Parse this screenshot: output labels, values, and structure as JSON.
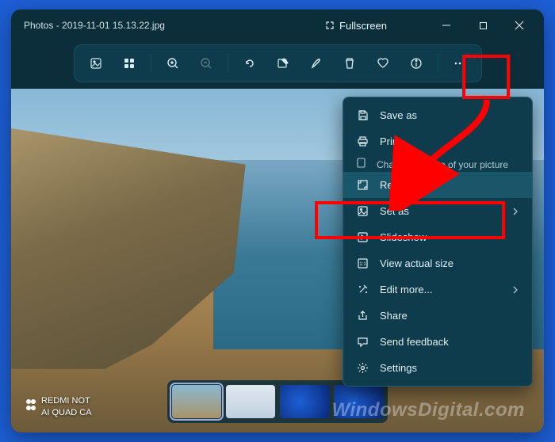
{
  "title_prefix": "Photos",
  "title_sep": " - ",
  "title_file": "2019-11-01 15.13.22.jpg",
  "fullscreen_label": "Fullscreen",
  "menu": {
    "save_as": "Save as",
    "print": "Print",
    "resize_caption": "Change the size of your picture",
    "resize": "Resize",
    "set_as": "Set as",
    "slideshow": "Slideshow",
    "view_actual": "View actual size",
    "edit_more": "Edit more...",
    "share": "Share",
    "feedback": "Send feedback",
    "settings": "Settings"
  },
  "camera_watermark": {
    "line1": "REDMI NOT",
    "line2": "AI QUAD CA"
  },
  "site_watermark": "WindowsDigital.com",
  "highlight_color": "#ff0000"
}
